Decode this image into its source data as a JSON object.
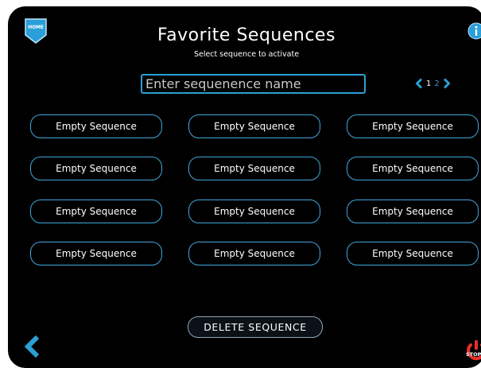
{
  "header": {
    "home_label": "HOME",
    "title": "Favorite Sequences",
    "subtitle": "Select sequence to activate"
  },
  "search": {
    "placeholder": "Enter sequenence name",
    "value": ""
  },
  "pager": {
    "pages": [
      "1",
      "2"
    ],
    "current": "1"
  },
  "sequences": [
    {
      "label": "Empty Sequence"
    },
    {
      "label": "Empty Sequence"
    },
    {
      "label": "Empty Sequence"
    },
    {
      "label": "Empty Sequence"
    },
    {
      "label": "Empty Sequence"
    },
    {
      "label": "Empty Sequence"
    },
    {
      "label": "Empty Sequence"
    },
    {
      "label": "Empty Sequence"
    },
    {
      "label": "Empty Sequence"
    },
    {
      "label": "Empty Sequence"
    },
    {
      "label": "Empty Sequence"
    },
    {
      "label": "Empty Sequence"
    }
  ],
  "footer": {
    "delete_label": "DELETE SEQUENCE",
    "stop_label": "STOP"
  },
  "colors": {
    "background": "#000000",
    "accent": "#2aa0d4",
    "stop": "#e8302a"
  },
  "icons": {
    "home": "home-badge-icon",
    "info": "info-icon",
    "prev_page": "chevron-left-icon",
    "next_page": "chevron-right-icon",
    "back": "back-chevron-icon",
    "stop": "power-stop-icon"
  }
}
